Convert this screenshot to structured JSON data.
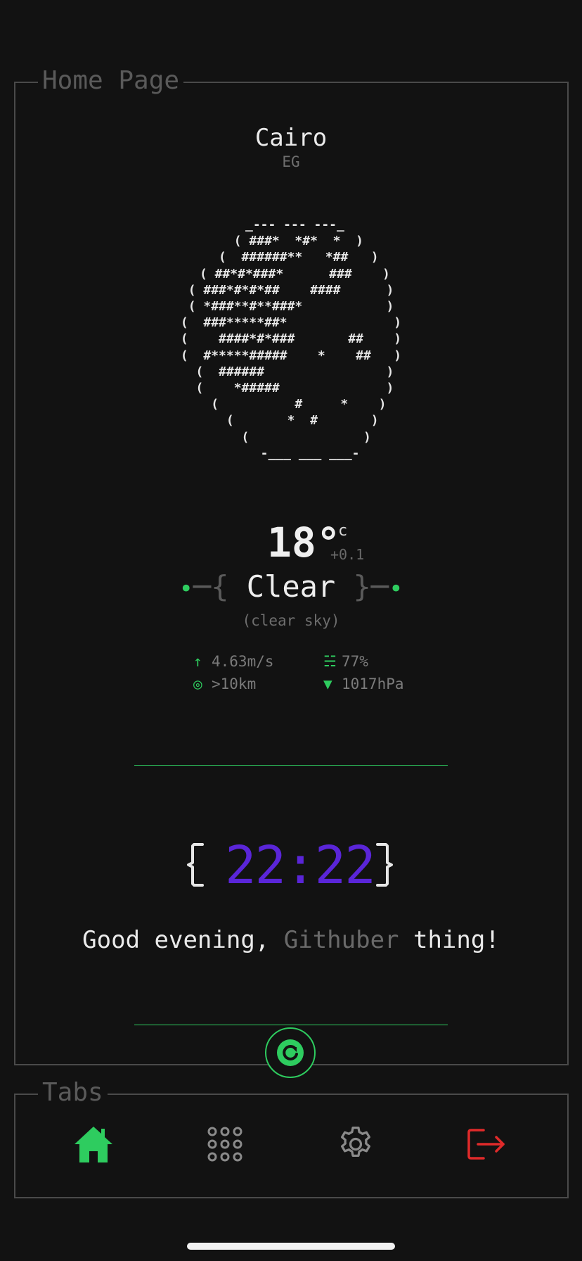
{
  "panels": {
    "home_title": "Home Page",
    "tabs_title": "Tabs"
  },
  "location": {
    "city": "Cairo",
    "country": "EG"
  },
  "ascii_art": " _--- --- ---_\n  ( ###*  *#*  *  )\n  (  ######**   *##   )\n ( ##*#*###*      ###    )\n( ###*#*#*##    ####      )\n( *###**#**###*           )\n(  ###*****##*              )\n(    ####*#*###       ##    )\n(  #*****#####    *    ##   )\n (  ######                )\n (    *#####              )\n  (          #     *    )\n   (       *  #       )\n    (               )\n     -___ ___ ___-",
  "weather": {
    "temperature": "18°",
    "unit": "c",
    "delta": "+0.1",
    "condition": "Clear",
    "condition_detail": "(clear sky)",
    "wind": "4.63m/s",
    "humidity": "77%",
    "visibility": ">10km",
    "pressure": "1017hPa"
  },
  "clock": {
    "time": "22:22"
  },
  "greeting": {
    "prefix": "Good evening, ",
    "name": "Githuber",
    "suffix": " thing!"
  },
  "icons": {
    "refresh": "refresh-icon",
    "home": "home-icon",
    "apps": "apps-grid-icon",
    "settings": "gear-icon",
    "logout": "logout-icon"
  },
  "colors": {
    "accent": "#2ecc5f",
    "clock": "#5a25d8",
    "logout": "#e02a2a",
    "background": "#121212"
  }
}
